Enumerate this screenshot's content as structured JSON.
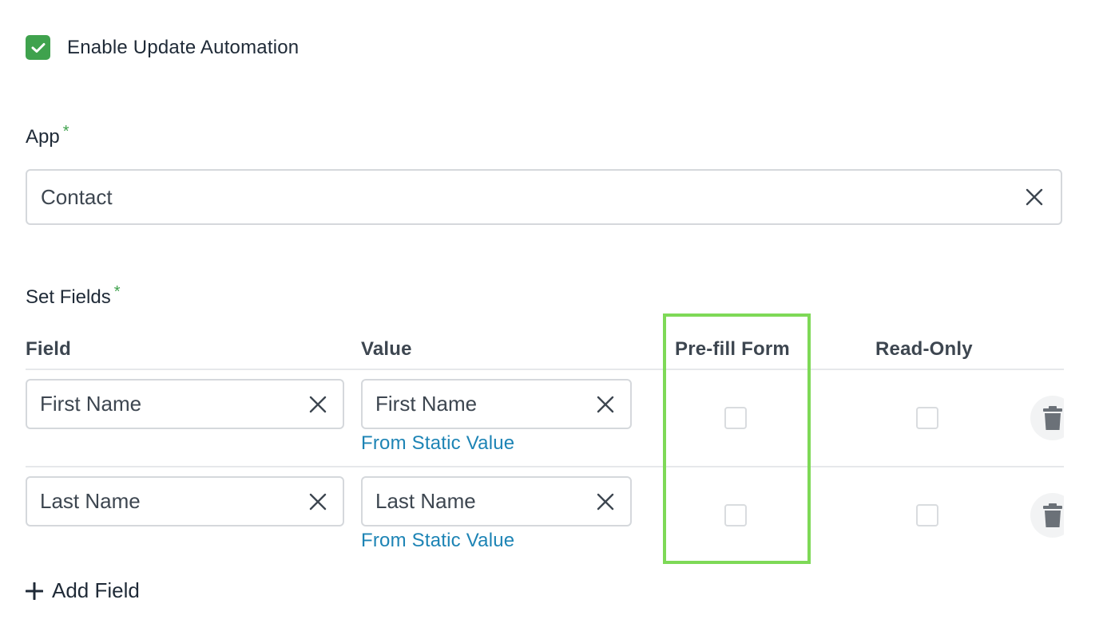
{
  "enable": {
    "label": "Enable Update Automation",
    "checked": true
  },
  "app": {
    "label": "App",
    "required_mark": "*",
    "value": "Contact"
  },
  "set_fields": {
    "label": "Set Fields",
    "required_mark": "*",
    "columns": {
      "field": "Field",
      "value": "Value",
      "prefill": "Pre-fill Form",
      "readonly": "Read-Only"
    },
    "rows": [
      {
        "field": "First Name",
        "value": "First Name",
        "source_link": "From Static Value",
        "prefill_checked": false,
        "readonly_checked": false
      },
      {
        "field": "Last Name",
        "value": "Last Name",
        "source_link": "From Static Value",
        "prefill_checked": false,
        "readonly_checked": false
      }
    ],
    "add_label": "Add Field"
  },
  "colors": {
    "accent_green": "#3fa24d",
    "link_blue": "#1d84b5",
    "highlight_green": "#7ed957"
  },
  "icons": {
    "enable_check": "check-icon",
    "clear": "close-icon",
    "delete": "trash-icon",
    "add": "plus-icon"
  }
}
